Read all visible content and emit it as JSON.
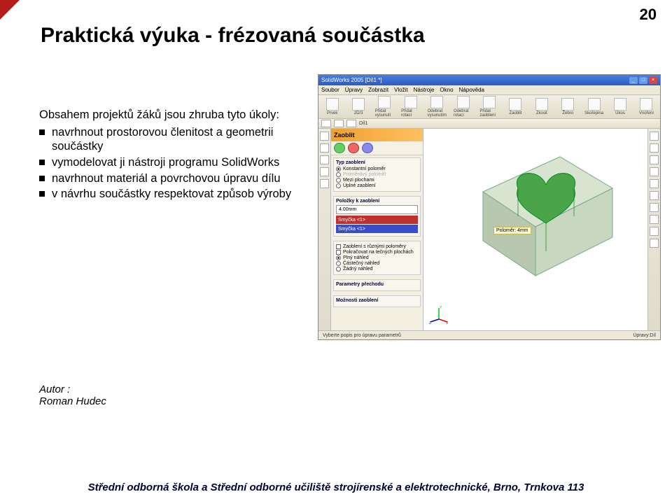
{
  "page_number": "20",
  "title": "Praktická výuka - frézovaná součástka",
  "intro": "Obsahem projektů žáků jsou zhruba tyto úkoly:",
  "bullets": [
    "navrhnout prostorovou členitost a geometrii součástky",
    "vymodelovat ji nástroji programu SolidWorks",
    "navrhnout materiál a povrchovou úpravu dílu",
    "v návrhu součástky respektovat způsob výroby"
  ],
  "author_label": "Autor :",
  "author_name": "Roman Hudec",
  "footer": "Střední odborná škola a Střední odborné učiliště strojírenské a elektrotechnické, Brno, Trnkova 113",
  "shot": {
    "title": "SolidWorks 2005   [Díl1 *]",
    "menu": [
      "Soubor",
      "Úpravy",
      "Zobrazit",
      "Vložit",
      "Nástroje",
      "Okno",
      "Nápověda"
    ],
    "ribbon": [
      "Prvek",
      "2D/3",
      "Přidat vysunutí",
      "Přidat rotací",
      "Odebrat vysunutím",
      "Odebrat rotací",
      "Přidat zaoblení",
      "Zaoblit",
      "Zkosit",
      "Žebro",
      "Skořepina",
      "Úkos",
      "Vnoření"
    ],
    "doc_item": "Díl1",
    "pm_title": "Zaoblit",
    "pm_sections": {
      "type": {
        "header": "Typ zaoblení",
        "r1": "Konstantní poloměr",
        "r2": "Proměnlivý poloměr",
        "r3": "Mezi plochami",
        "r4": "Úplné zaoblení"
      },
      "items": {
        "header": "Položky k zaoblení",
        "val": "4.00mm",
        "sel1": "Smyčka <1>",
        "sel2": "Smyčka <1>"
      },
      "opts": {
        "c1": "Zaoblení s různými poloměry",
        "c2": "Pokračovat na tečných plochách",
        "r1": "Plný náhled",
        "r2": "Částečný náhled",
        "r3": "Žádný náhled"
      },
      "trans": "Parametry přechodu",
      "more": "Možnosti zaoblení"
    },
    "callout": "Poloměr: 4mm",
    "status_left": "Vyberte popis pro úpravu parametrů",
    "status_right": "Úpravy:Díl"
  }
}
